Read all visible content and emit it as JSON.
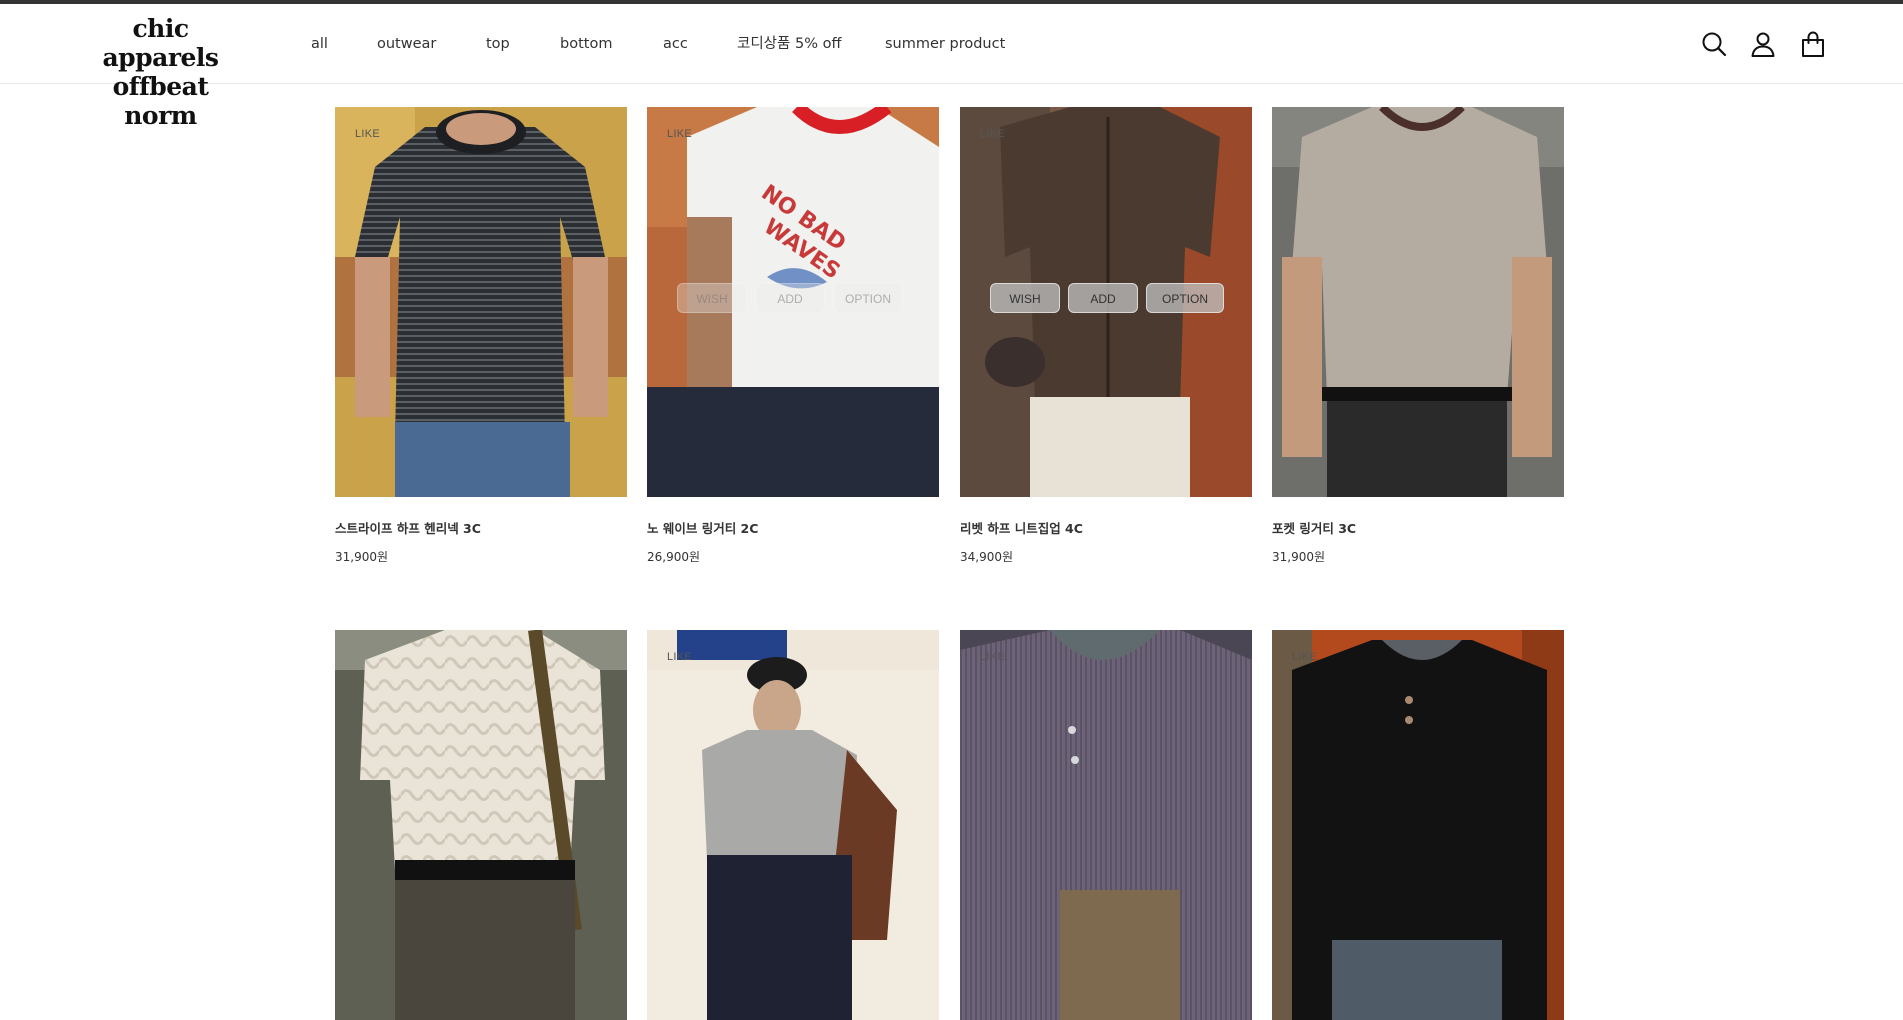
{
  "brand": {
    "line1": "chic apparels",
    "line2": "offbeat norm"
  },
  "nav": [
    "all",
    "outwear",
    "top",
    "bottom",
    "acc",
    "코디상품 5% off",
    "summer product"
  ],
  "header_icons": [
    "search-icon",
    "user-icon",
    "cart-icon"
  ],
  "like_label": "LIKE",
  "overlay_buttons": {
    "wish": "WISH",
    "add": "ADD",
    "option": "OPTION"
  },
  "products_row1": [
    {
      "name": "스트라이프 하프 헨리넥 3C",
      "price": "31,900원"
    },
    {
      "name": "노 웨이브 링거티 2C",
      "price": "26,900원"
    },
    {
      "name": "리벳 하프 니트집업 4C",
      "price": "34,900원"
    },
    {
      "name": "포켓 링거티 3C",
      "price": "31,900원"
    }
  ],
  "colors": {
    "accent_bar": "#333333",
    "text": "#333333"
  }
}
